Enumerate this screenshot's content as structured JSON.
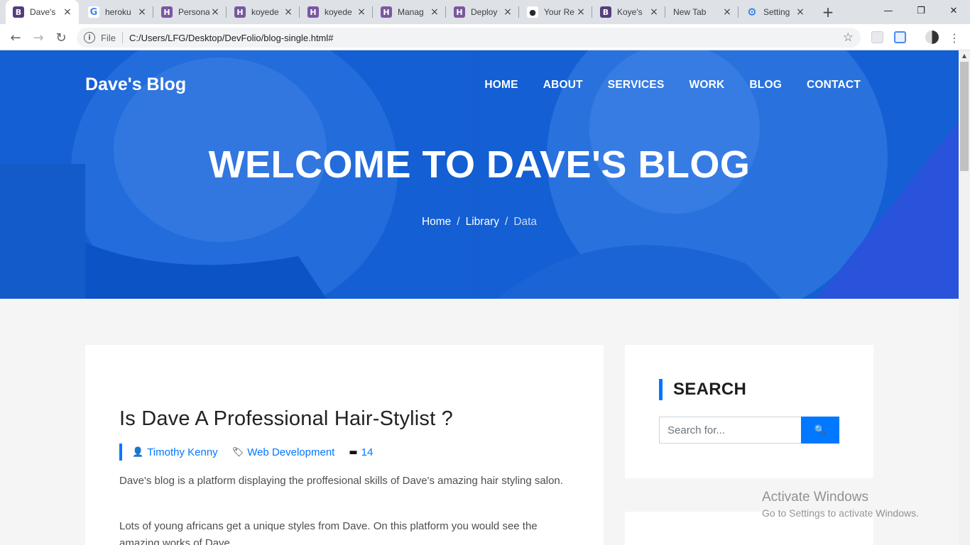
{
  "browser": {
    "tabs": [
      {
        "title": "Dave's",
        "favicon": "bootstrap-icon",
        "active": true
      },
      {
        "title": "heroku",
        "favicon": "google-icon"
      },
      {
        "title": "Persona",
        "favicon": "heroku-icon"
      },
      {
        "title": "koyede",
        "favicon": "heroku-icon"
      },
      {
        "title": "koyede",
        "favicon": "heroku-icon"
      },
      {
        "title": "Manag",
        "favicon": "heroku-icon"
      },
      {
        "title": "Deploy",
        "favicon": "heroku-icon"
      },
      {
        "title": "Your Re",
        "favicon": "github-icon"
      },
      {
        "title": "Koye's",
        "favicon": "bootstrap-icon"
      },
      {
        "title": "New Tab",
        "favicon": "none"
      },
      {
        "title": "Setting",
        "favicon": "gear-icon"
      }
    ],
    "favicon_glyphs": {
      "bootstrap": "B",
      "heroku": "H",
      "google": "G",
      "github": "●",
      "gear": "⚙"
    },
    "address_bar": {
      "scheme_label": "File",
      "url": "C:/Users/LFG/Desktop/DevFolio/blog-single.html#"
    },
    "icons": {
      "back": "←",
      "forward": "→",
      "reload": "↻",
      "info": "i",
      "star": "☆",
      "new_tab": "+",
      "tab_close": "×",
      "minimize": "—",
      "maximize": "❐",
      "close": "✕",
      "menu": "⋮",
      "scroll_up": "▲"
    }
  },
  "site": {
    "brand": "Dave's Blog",
    "nav": [
      "HOME",
      "ABOUT",
      "SERVICES",
      "WORK",
      "BLOG",
      "CONTACT"
    ],
    "hero_title": "WELCOME TO DAVE'S BLOG",
    "breadcrumb": {
      "home": "Home",
      "library": "Library",
      "current": "Data",
      "separator": "/"
    }
  },
  "post": {
    "title": "Is Dave A Professional Hair-Stylist ?",
    "author": "Timothy Kenny",
    "category": "Web Development",
    "comments": "14",
    "meta_icons": {
      "author": "👤",
      "category": "🏷",
      "comments": "▬"
    },
    "paragraphs": [
      "Dave's blog is a platform displaying the proffesional skills of Dave's amazing hair styling salon.",
      "Lots of young africans get a unique styles from Dave. On this platform you would see the amazing works of Dave."
    ]
  },
  "sidebar": {
    "search_title": "SEARCH",
    "search_placeholder": "Search for...",
    "search_icon": "🔍"
  },
  "windows_watermark": {
    "line1": "Activate Windows",
    "line2": "Go to Settings to activate Windows."
  },
  "colors": {
    "accent": "#0078ff",
    "hero_overlay": "#1a5fcf"
  }
}
